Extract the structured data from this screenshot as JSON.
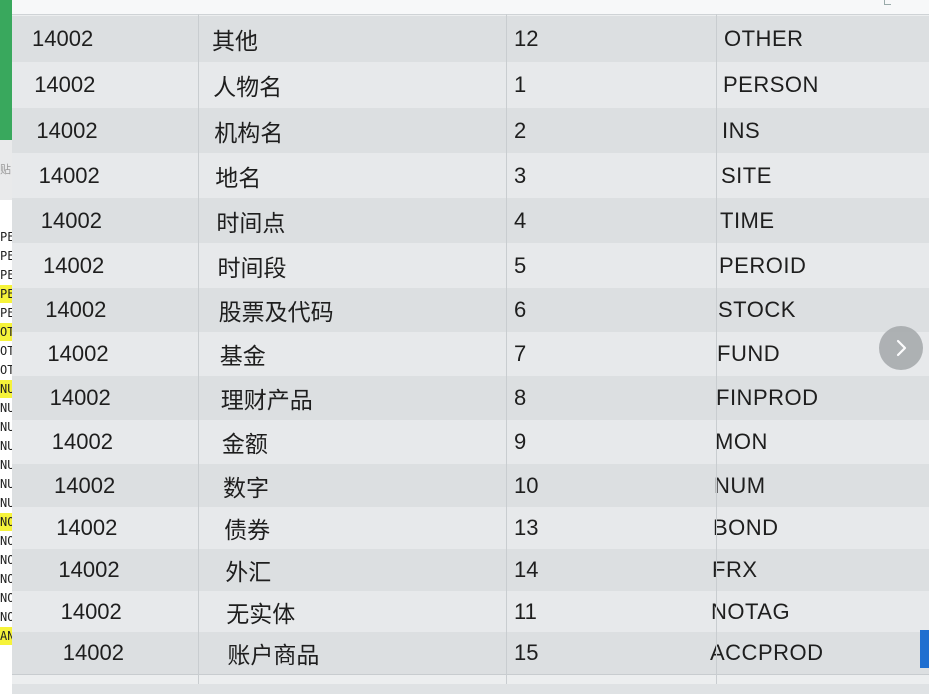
{
  "rows": [
    {
      "code": "14002",
      "name": "其他",
      "num": "12",
      "tag": "OTHER"
    },
    {
      "code": "14002",
      "name": "人物名",
      "num": "1",
      "tag": "PERSON"
    },
    {
      "code": "14002",
      "name": "机构名",
      "num": "2",
      "tag": "INS"
    },
    {
      "code": "14002",
      "name": "地名",
      "num": "3",
      "tag": "SITE"
    },
    {
      "code": "14002",
      "name": "时间点",
      "num": "4",
      "tag": "TIME"
    },
    {
      "code": "14002",
      "name": "时间段",
      "num": "5",
      "tag": "PEROID"
    },
    {
      "code": "14002",
      "name": "股票及代码",
      "num": "6",
      "tag": "STOCK"
    },
    {
      "code": "14002",
      "name": "基金",
      "num": "7",
      "tag": "FUND"
    },
    {
      "code": "14002",
      "name": "理财产品",
      "num": "8",
      "tag": "FINPROD"
    },
    {
      "code": "14002",
      "name": "金额",
      "num": "9",
      "tag": "MON"
    },
    {
      "code": "14002",
      "name": "数字",
      "num": "10",
      "tag": "NUM"
    },
    {
      "code": "14002",
      "name": "债券",
      "num": "13",
      "tag": "BOND"
    },
    {
      "code": "14002",
      "name": "外汇",
      "num": "14",
      "tag": "FRX"
    },
    {
      "code": "14002",
      "name": "无实体",
      "num": "11",
      "tag": "NOTAG"
    },
    {
      "code": "14002",
      "name": "账户商品",
      "num": "15",
      "tag": "ACCPROD"
    }
  ],
  "left_fragments": [
    {
      "text": "PE",
      "highlight": false
    },
    {
      "text": "PE",
      "highlight": false
    },
    {
      "text": "PE",
      "highlight": false
    },
    {
      "text": "PE",
      "highlight": true
    },
    {
      "text": "PE",
      "highlight": false
    },
    {
      "text": "OT",
      "highlight": true
    },
    {
      "text": "OT",
      "highlight": false
    },
    {
      "text": "OT",
      "highlight": false
    },
    {
      "text": "NU",
      "highlight": true
    },
    {
      "text": "NU",
      "highlight": false
    },
    {
      "text": "NU",
      "highlight": false
    },
    {
      "text": "NU",
      "highlight": false
    },
    {
      "text": "NU",
      "highlight": false
    },
    {
      "text": "NU",
      "highlight": false
    },
    {
      "text": "NU",
      "highlight": false
    },
    {
      "text": "NO",
      "highlight": true
    },
    {
      "text": "NO",
      "highlight": false
    },
    {
      "text": "NO",
      "highlight": false
    },
    {
      "text": "NO",
      "highlight": false
    },
    {
      "text": "NO",
      "highlight": false
    },
    {
      "text": "NO",
      "highlight": false
    },
    {
      "text": "AN",
      "highlight": true
    }
  ],
  "left_mid_text": "贴",
  "colors": {
    "row_even": "#dcdfe1",
    "row_odd": "#e7e9eb",
    "text": "#1e1e1e",
    "highlight": "#f6f33a",
    "accent_green": "#39a85d",
    "accent_blue": "#1f6fd0"
  },
  "icons": {
    "next": "chevron-right-icon"
  }
}
